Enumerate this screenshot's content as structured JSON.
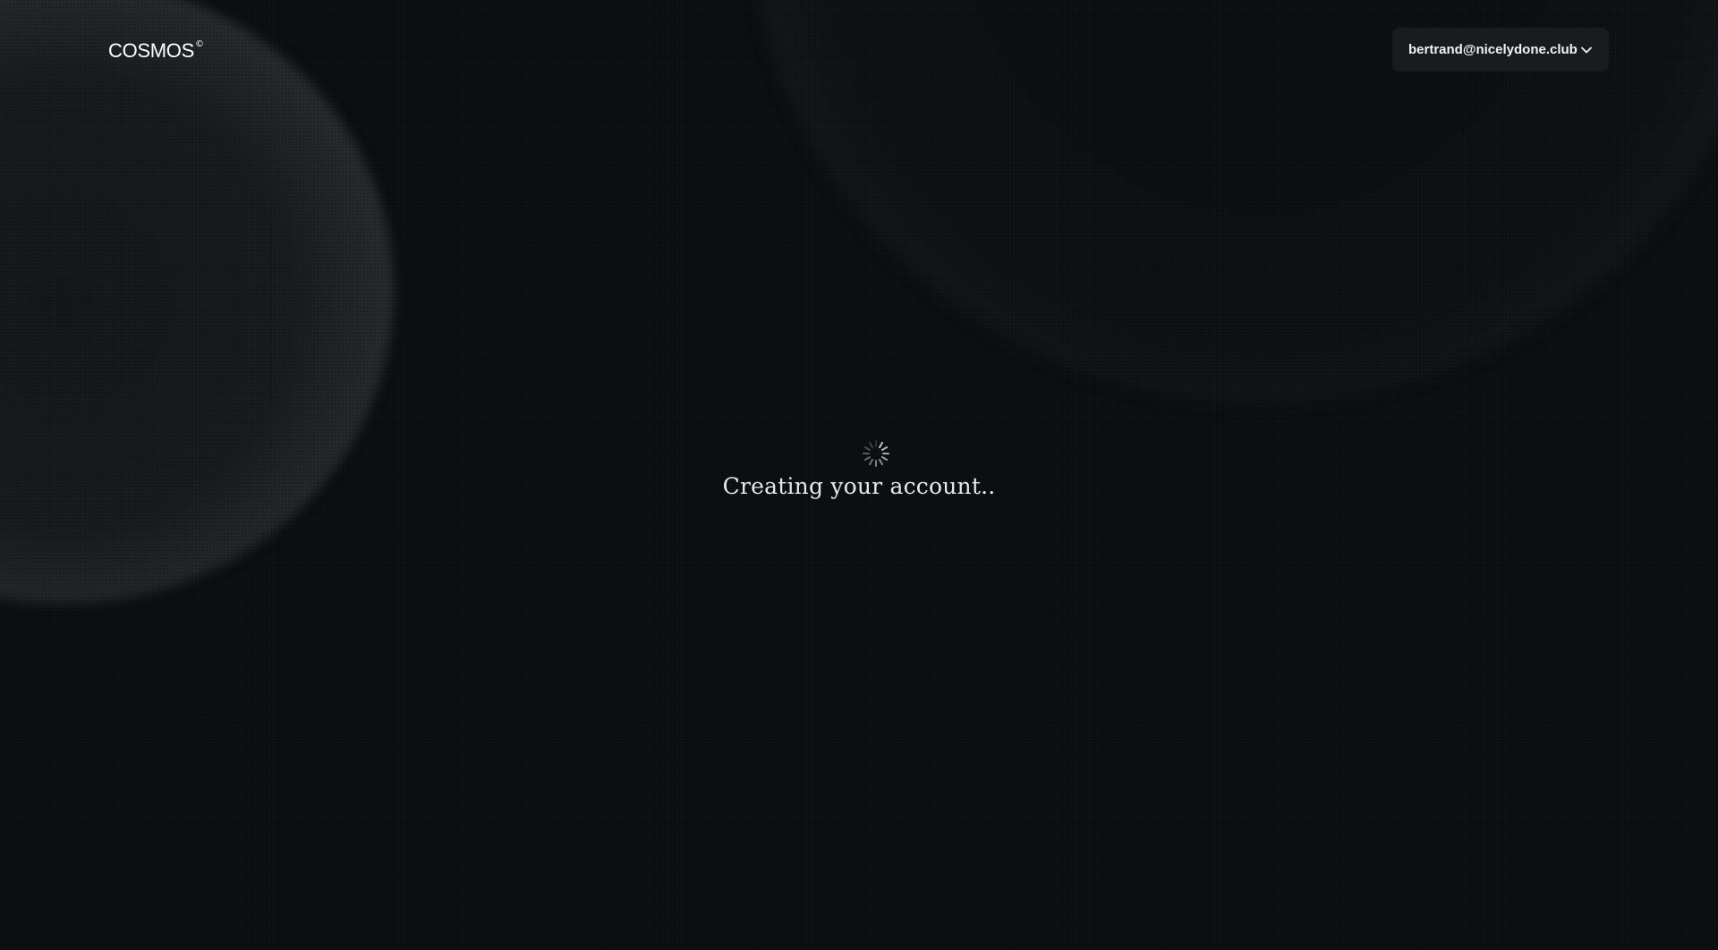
{
  "brand": {
    "name": "COSMOS",
    "mark": "©"
  },
  "account": {
    "email": "bertrand@nicelydone.club",
    "icon": "chevron-down-icon"
  },
  "loading": {
    "icon": "spinner-icon",
    "message": "Creating your account.."
  },
  "colors": {
    "background": "#0c0d0f",
    "button_bg": "#1a1b1d",
    "text": "#e8e8e8"
  }
}
